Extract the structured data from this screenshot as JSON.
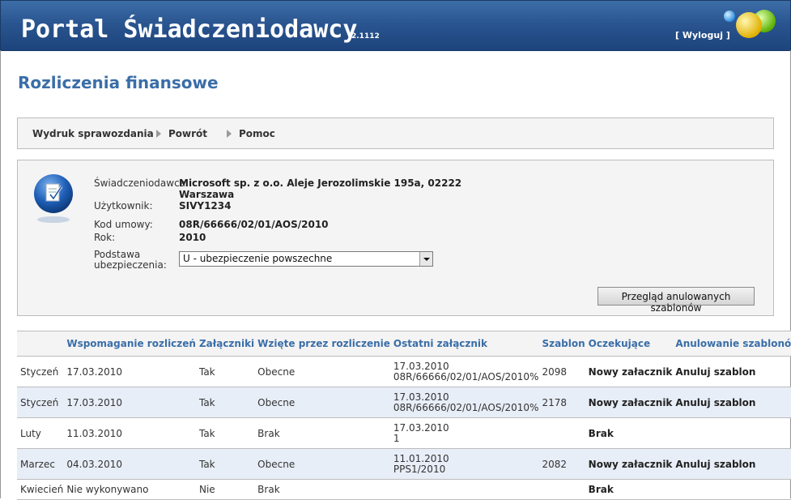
{
  "header": {
    "title": "Portal Świadczeniodawcy",
    "version": "2.1112",
    "logout_label": "[ Wyloguj ]"
  },
  "page": {
    "title": "Rozliczenia finansowe"
  },
  "nav": {
    "items": [
      "Wydruk sprawozdania",
      "Powrót",
      "Pomoc"
    ]
  },
  "info": {
    "provider_label": "Świadczeniodawca:",
    "provider_value_line1": "Microsoft sp. z o.o. Aleje Jerozolimskie 195a, 02222",
    "provider_value_line2": "Warszawa",
    "user_label": "Użytkownik:",
    "user_value": "SIVY1234",
    "contract_label": "Kod umowy:",
    "contract_value": "08R/66666/02/01/AOS/2010",
    "year_label": "Rok:",
    "year_value": "2010",
    "basis_label_line1": "Podstawa",
    "basis_label_line2": "ubezpieczenia:",
    "basis_selected": "U - ubezpieczenie powszechne",
    "cancelled_button": "Przegląd anulowanych szablonów"
  },
  "table": {
    "headers": [
      "",
      "Wspomaganie rozliczeń",
      "Załączniki",
      "Wzięte przez rozliczenie",
      "Ostatni załącznik",
      "Szablon",
      "Oczekujące",
      "Anulowanie szablonów"
    ],
    "rows": [
      {
        "month": "Styczeń",
        "support": "17.03.2010",
        "attach": "Tak",
        "taken": "Obecne",
        "last1": "17.03.2010",
        "last2": "08R/66666/02/01/AOS/2010%",
        "template": "2098",
        "pending": "Nowy załacznik",
        "cancel": "Anuluj szablon"
      },
      {
        "month": "Styczeń",
        "support": "17.03.2010",
        "attach": "Tak",
        "taken": "Obecne",
        "last1": "17.03.2010",
        "last2": "08R/66666/02/01/AOS/2010%",
        "template": "2178",
        "pending": "Nowy załacznik",
        "cancel": "Anuluj szablon"
      },
      {
        "month": "Luty",
        "support": "11.03.2010",
        "attach": "Tak",
        "taken": "Brak",
        "last1": "17.03.2010",
        "last2": "1",
        "template": "",
        "pending": "Brak",
        "cancel": ""
      },
      {
        "month": "Marzec",
        "support": "04.03.2010",
        "attach": "Tak",
        "taken": "Obecne",
        "last1": "11.01.2010",
        "last2": "PPS1/2010",
        "template": "2082",
        "pending": "Nowy załacznik",
        "cancel": "Anuluj szablon"
      },
      {
        "month": "Kwiecień",
        "support": "Nie wykonywano",
        "attach": "Nie",
        "taken": "Brak",
        "last1": "",
        "last2": "",
        "template": "",
        "pending": "Brak",
        "cancel": ""
      }
    ]
  },
  "colors": {
    "header_blue": "#2a5590",
    "title_blue": "#3a6ea8",
    "row_alt": "#e8eef7"
  }
}
